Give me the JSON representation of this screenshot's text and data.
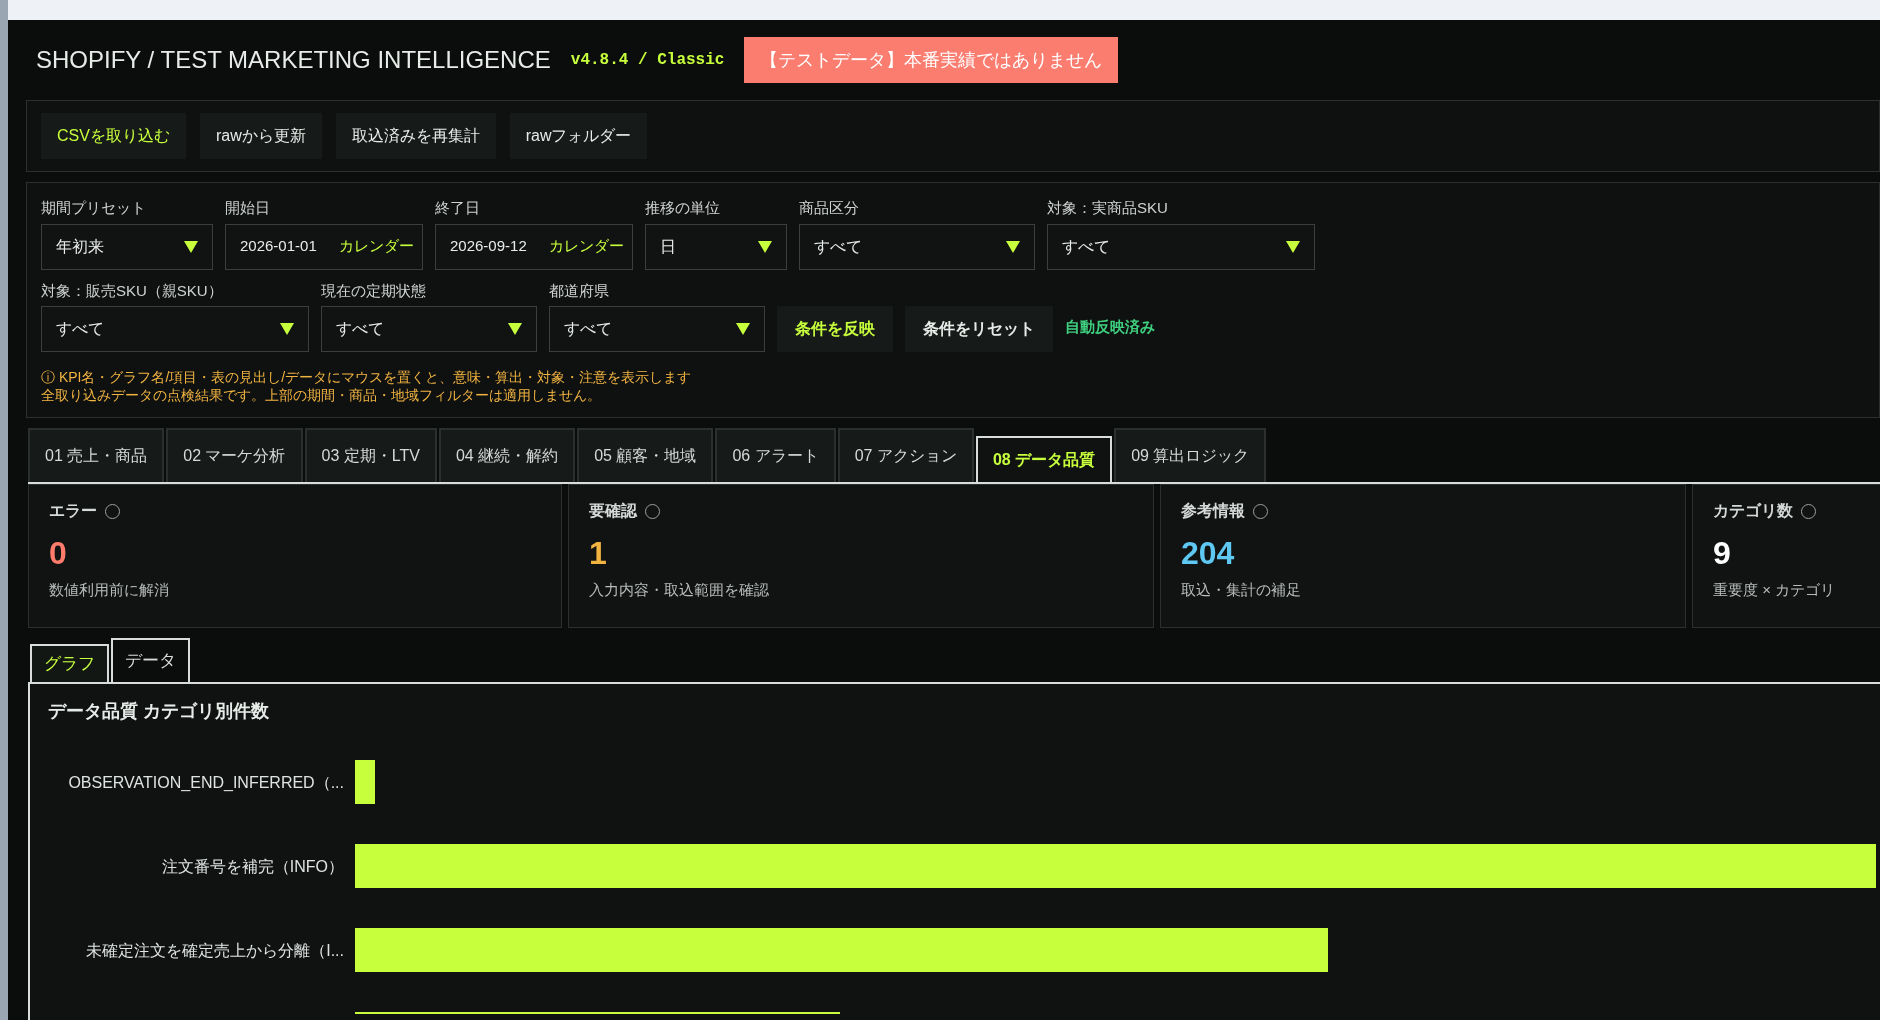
{
  "header": {
    "title": "SHOPIFY / TEST MARKETING INTELLIGENCE",
    "version": "v4.8.4 / Classic",
    "badge": "【テストデータ】本番実績ではありません"
  },
  "toolbar": [
    {
      "label": "CSVを取り込む",
      "primary": true
    },
    {
      "label": "rawから更新",
      "primary": false
    },
    {
      "label": "取込済みを再集計",
      "primary": false
    },
    {
      "label": "rawフォルダー",
      "primary": false
    }
  ],
  "filters": [
    {
      "kind": "select",
      "label": "期間プリセット",
      "value": "年初来"
    },
    {
      "kind": "date",
      "label": "開始日",
      "value": "2026-01-01",
      "button": "カレンダー"
    },
    {
      "kind": "date",
      "label": "終了日",
      "value": "2026-09-12",
      "button": "カレンダー"
    },
    {
      "kind": "select",
      "label": "推移の単位",
      "value": "日"
    },
    {
      "kind": "select",
      "label": "商品区分",
      "value": "すべて"
    },
    {
      "kind": "select",
      "label": "対象：実商品SKU",
      "value": "すべて"
    },
    {
      "kind": "select",
      "label": "対象：販売SKU（親SKU）",
      "value": "すべて"
    },
    {
      "kind": "select",
      "label": "現在の定期状態",
      "value": "すべて"
    },
    {
      "kind": "select",
      "label": "都道府県",
      "value": "すべて"
    }
  ],
  "filter_actions": [
    {
      "label": "条件を反映",
      "primary": true
    },
    {
      "label": "条件をリセット",
      "primary": false
    }
  ],
  "auto_status": "自動反映済み",
  "notes": [
    "ⓘ KPI名・グラフ名/項目・表の見出し/データにマウスを置くと、意味・算出・対象・注意を表示します",
    "全取り込みデータの点検結果です。上部の期間・商品・地域フィルターは適用しません。"
  ],
  "tabs": [
    {
      "label": "01 売上・商品",
      "selected": false
    },
    {
      "label": "02 マーケ分析",
      "selected": false
    },
    {
      "label": "03 定期・LTV",
      "selected": false
    },
    {
      "label": "04 継続・解約",
      "selected": false
    },
    {
      "label": "05 顧客・地域",
      "selected": false
    },
    {
      "label": "06 アラート",
      "selected": false
    },
    {
      "label": "07 アクション",
      "selected": false
    },
    {
      "label": "08 データ品質",
      "selected": true
    },
    {
      "label": "09 算出ロジック",
      "selected": false
    }
  ],
  "kpis": [
    {
      "label": "エラー",
      "value": "0",
      "note": "数値利用前に解消",
      "color": "#ff7b6b"
    },
    {
      "label": "要確認",
      "value": "1",
      "note": "入力内容・取込範囲を確認",
      "color": "#f2b441"
    },
    {
      "label": "参考情報",
      "value": "204",
      "note": "取込・集計の補足",
      "color": "#5ec8f2"
    },
    {
      "label": "カテゴリ数",
      "value": "9",
      "note": "重要度 × カテゴリ",
      "color": "#ffffff"
    }
  ],
  "view_tabs": [
    {
      "label": "グラフ",
      "selected": true
    },
    {
      "label": "データ",
      "selected": false
    }
  ],
  "chart": {
    "title": "データ品質 カテゴリ別件数",
    "category_labels": [
      "OBSERVATION_END_INFERRED（...",
      "注文番号を補完（INFO）",
      "未確定注文を確定売上から分離（I..."
    ]
  }
}
